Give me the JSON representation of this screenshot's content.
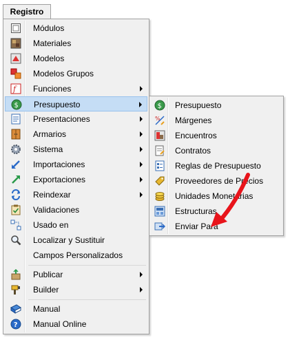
{
  "menubar": {
    "tab_label": "Registro"
  },
  "main_menu": {
    "items": [
      {
        "label": "Módulos",
        "icon": "modules-icon"
      },
      {
        "label": "Materiales",
        "icon": "materials-icon"
      },
      {
        "label": "Modelos",
        "icon": "models-icon"
      },
      {
        "label": "Modelos Grupos",
        "icon": "model-groups-icon"
      },
      {
        "label": "Funciones",
        "icon": "functions-icon",
        "submenu": true
      },
      {
        "label": "Presupuesto",
        "icon": "budget-icon",
        "submenu": true,
        "selected": true
      },
      {
        "label": "Presentaciones",
        "icon": "presentations-icon",
        "submenu": true
      },
      {
        "label": "Armarios",
        "icon": "wardrobes-icon",
        "submenu": true
      },
      {
        "label": "Sistema",
        "icon": "system-gear-icon",
        "submenu": true
      },
      {
        "label": "Importaciones",
        "icon": "import-icon",
        "submenu": true
      },
      {
        "label": "Exportaciones",
        "icon": "export-icon",
        "submenu": true
      },
      {
        "label": "Reindexar",
        "icon": "reindex-icon",
        "submenu": true
      },
      {
        "label": "Validaciones",
        "icon": "validations-icon"
      },
      {
        "label": "Usado en",
        "icon": "used-in-icon"
      },
      {
        "label": "Localizar y Sustituir",
        "icon": "search-replace-icon"
      },
      {
        "label": "Campos Personalizados",
        "icon": ""
      },
      {
        "label": "Publicar",
        "icon": "publish-icon",
        "submenu": true
      },
      {
        "label": "Builder",
        "icon": "builder-icon",
        "submenu": true
      },
      {
        "label": "Manual",
        "icon": "manual-book-icon"
      },
      {
        "label": "Manual Online",
        "icon": "help-icon"
      }
    ]
  },
  "sub_menu": {
    "items": [
      {
        "label": "Presupuesto",
        "icon": "budget-icon"
      },
      {
        "label": "Márgenes",
        "icon": "margins-icon"
      },
      {
        "label": "Encuentros",
        "icon": "encounters-icon"
      },
      {
        "label": "Contratos",
        "icon": "contracts-icon"
      },
      {
        "label": "Reglas de Presupuesto",
        "icon": "budget-rules-icon"
      },
      {
        "label": "Proveedores de Precios",
        "icon": "price-providers-icon"
      },
      {
        "label": "Unidades Monetarias",
        "icon": "currency-units-icon"
      },
      {
        "label": "Estructuras",
        "icon": "structures-icon"
      },
      {
        "label": "Enviar Para",
        "icon": "send-to-icon"
      }
    ]
  },
  "colors": {
    "menu_bg": "#f0f0f0",
    "selected_bg": "#c5ddf5",
    "selected_border": "#99c2ec",
    "annotation_arrow": "#e8141b"
  }
}
